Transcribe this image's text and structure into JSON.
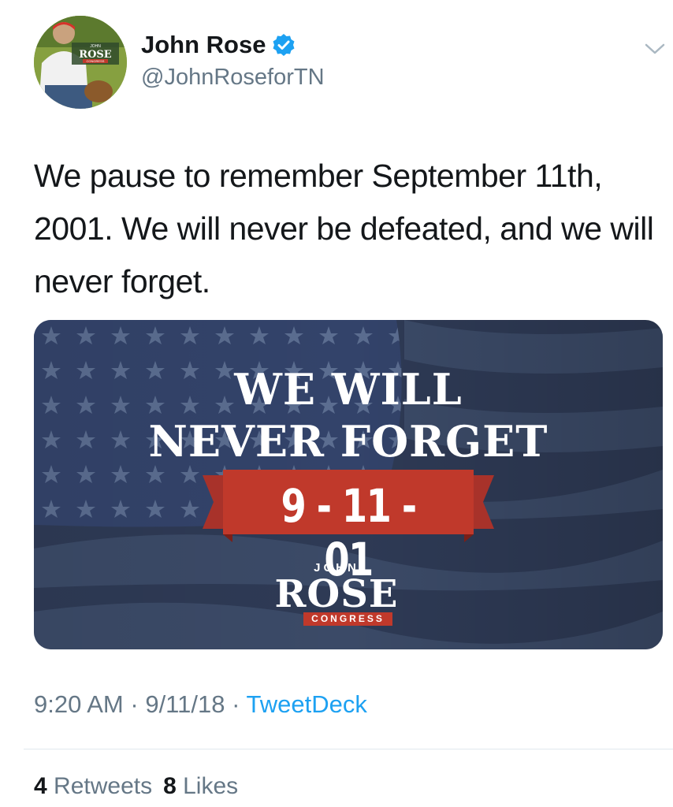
{
  "author": {
    "display_name": "John Rose",
    "handle": "@JohnRoseforTN",
    "avatar_logo": {
      "top": "JOHN",
      "main": "ROSE",
      "bottom": "CONGRESS"
    }
  },
  "tweet": {
    "text": "We pause to remember September 11th, 2001. We will never be defeated, and we will never forget.",
    "image": {
      "headline_line1": "WE WILL",
      "headline_line2": "NEVER FORGET",
      "date_banner": "9 - 11 - 01",
      "logo_top": "JOHN",
      "logo_main": "ROSE",
      "logo_bottom": "CONGRESS"
    },
    "time": "9:20 AM",
    "date": "9/11/18",
    "separator": "·",
    "source": "TweetDeck"
  },
  "stats": {
    "retweets_count": "4",
    "retweets_label": "Retweets",
    "likes_count": "8",
    "likes_label": "Likes"
  },
  "colors": {
    "verified": "#1da1f2",
    "link": "#1da1f2",
    "banner_red": "#c0392b",
    "flag_navy": "#2e3a55"
  }
}
